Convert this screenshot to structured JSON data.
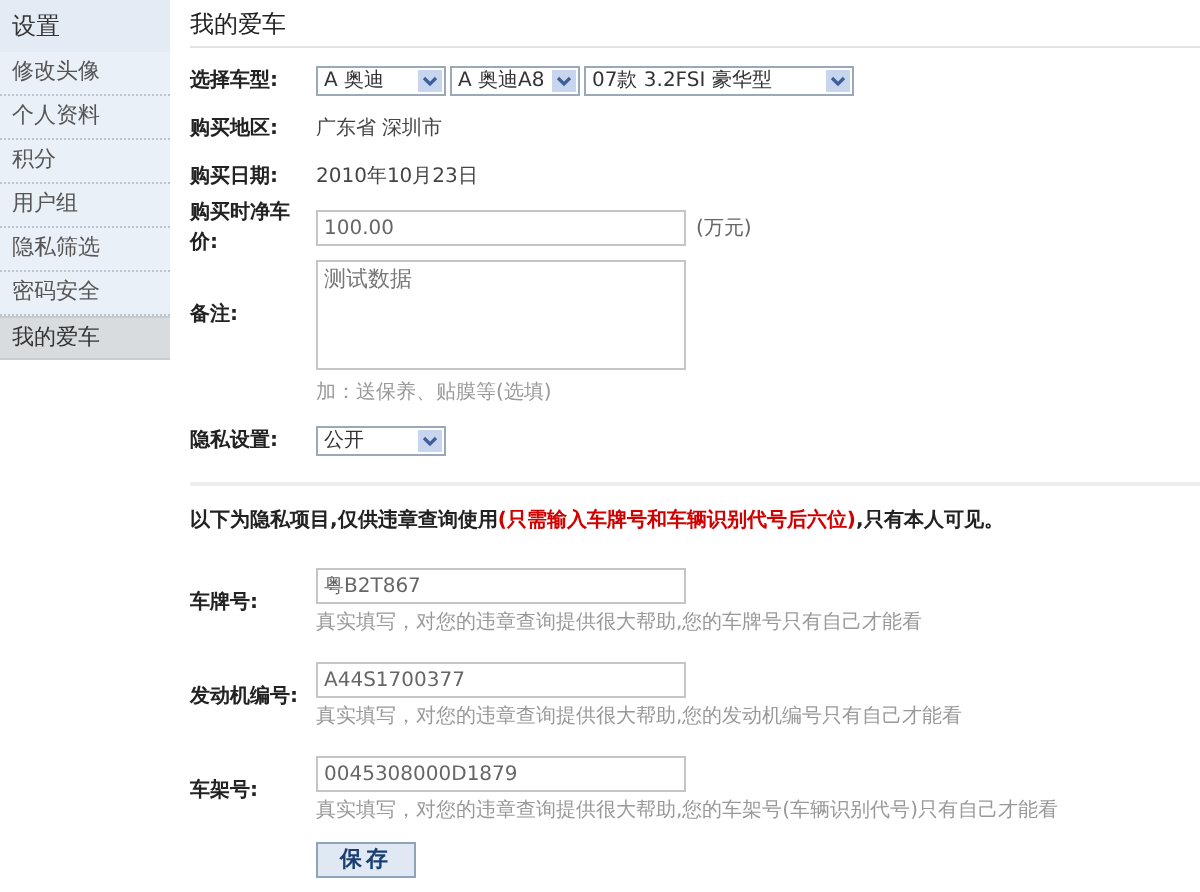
{
  "sidebar": {
    "title": "设置",
    "items": [
      {
        "label": "修改头像",
        "selected": false
      },
      {
        "label": "个人资料",
        "selected": false
      },
      {
        "label": "积分",
        "selected": false
      },
      {
        "label": "用户组",
        "selected": false
      },
      {
        "label": "隐私筛选",
        "selected": false
      },
      {
        "label": "密码安全",
        "selected": false
      },
      {
        "label": "我的爱车",
        "selected": true
      }
    ]
  },
  "page_title": "我的爱车",
  "fields": [
    {
      "kind": "selects",
      "label": "选择车型:",
      "options": [
        "A 奥迪",
        "A 奥迪A8",
        "07款 3.2FSI 豪华型"
      ]
    },
    {
      "kind": "text",
      "label": "购买地区:",
      "value": "广东省 深圳市"
    },
    {
      "kind": "text",
      "label": "购买日期:",
      "value": "2010年10月23日"
    },
    {
      "kind": "input",
      "label": "购买时净车价:",
      "value": "100.00",
      "unit": "(万元)"
    },
    {
      "kind": "textarea",
      "label": "备注:",
      "value": "测试数据",
      "hint": "加：送保养、贴膜等(选填)"
    },
    {
      "kind": "selects",
      "label": "隐私设置:",
      "options": [
        "公开"
      ]
    }
  ],
  "notice": {
    "before": "以下为隐私项目,仅供违章查询使用",
    "highlight": "(只需输入车牌号和车辆识别代号后六位)",
    "after": ",只有本人可见。"
  },
  "private_fields": [
    {
      "label": "车牌号:",
      "value": "粤B2T867",
      "hint": "真实填写，对您的违章查询提供很大帮助,您的车牌号只有自己才能看"
    },
    {
      "label": "发动机编号:",
      "value": "A44S1700377",
      "hint": "真实填写，对您的违章查询提供很大帮助,您的发动机编号只有自己才能看"
    },
    {
      "label": "车架号:",
      "value": "0045308000D1879",
      "hint": "真实填写，对您的违章查询提供很大帮助,您的车架号(车辆识别代号)只有自己才能看"
    }
  ],
  "save_button": "保存"
}
